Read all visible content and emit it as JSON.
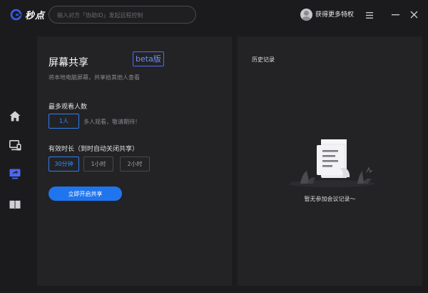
{
  "app": {
    "name": "秒点",
    "brand_color": "#3a5df0"
  },
  "header": {
    "search_placeholder": "输入对方「协助ID」发起远程控制",
    "vip_label": "获得更多特权"
  },
  "nav": {
    "items": [
      {
        "id": "home",
        "icon": "home-icon"
      },
      {
        "id": "remote",
        "icon": "remote-desktop-icon"
      },
      {
        "id": "share",
        "icon": "screen-share-icon",
        "active": true
      },
      {
        "id": "book",
        "icon": "book-icon"
      }
    ]
  },
  "share_panel": {
    "title": "屏幕共享",
    "badge": "beta版",
    "subtitle": "将本地电脑屏幕，共享给其他人查看",
    "viewers": {
      "label": "最多观看人数",
      "options": [
        "1人"
      ],
      "selected": "1人",
      "hint": "多人观看，敬请期待！"
    },
    "duration": {
      "label": "有效时长（到时自动关闭共享）",
      "options": [
        "30分钟",
        "1小时",
        "2小时"
      ],
      "selected": "30分钟"
    },
    "start_button": "立即开启共享"
  },
  "history_panel": {
    "title": "历史记录",
    "empty_text": "暂无参加会议记录～"
  },
  "colors": {
    "accent": "#1f75ee",
    "active_text": "#3a8bff",
    "panel_bg": "#232325",
    "app_bg": "#1b1b1d"
  }
}
